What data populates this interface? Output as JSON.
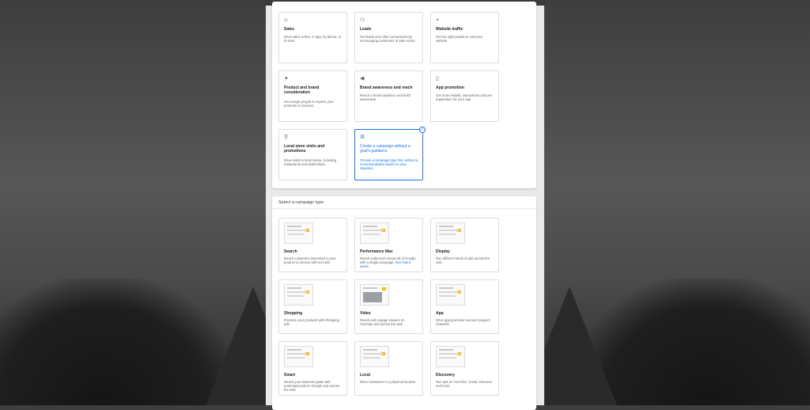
{
  "colors": {
    "accent": "#1a73e8",
    "highlight": "#fbbc04"
  },
  "goals": [
    {
      "icon": "tag-icon",
      "glyph": "⬦",
      "title": "Sales",
      "desc": "Drive sales online, in app, by phone, or in store"
    },
    {
      "icon": "people-icon",
      "glyph": "⚇",
      "title": "Leads",
      "desc": "Get leads and other conversions by encouraging customers to take action"
    },
    {
      "icon": "cursor-icon",
      "glyph": "⌖",
      "title": "Website traffic",
      "desc": "Get the right people to visit your website"
    },
    {
      "icon": "sparkle-icon",
      "glyph": "✦",
      "title": "Product and brand consideration",
      "desc": "Encourage people to explore your products or services"
    },
    {
      "icon": "megaphone-icon",
      "glyph": "◀",
      "title": "Brand awareness and reach",
      "desc": "Reach a broad audience and build awareness"
    },
    {
      "icon": "phone-icon",
      "glyph": "▯",
      "title": "App promotion",
      "desc": "Get more installs, interactions and pre-registration for your app"
    },
    {
      "icon": "location-pin-icon",
      "glyph": "⚲",
      "title": "Local store visits and promotions",
      "desc": "Drive visits to local stores, including restaurants and dealerships."
    },
    {
      "icon": "gear-icon",
      "glyph": "⚙",
      "title": "Create a campaign without a goal's guidance",
      "desc": "Choose a campaign type first, without a recommendation based on your objective",
      "selected": true
    }
  ],
  "campaign_section": {
    "title": "Select a campaign type"
  },
  "campaign_types": [
    {
      "title": "Search",
      "desc": "Reach customers interested in your product or service with text ads",
      "thumb": "lines"
    },
    {
      "title": "Performance Max",
      "desc": "Reach audiences across all of Google with a single campaign.",
      "link": "See how it works",
      "thumb": "lines"
    },
    {
      "title": "Display",
      "desc": "Run different kinds of ads across the web",
      "thumb": "lines"
    },
    {
      "title": "Shopping",
      "desc": "Promote your products with Shopping ads",
      "thumb": "lines"
    },
    {
      "title": "Video",
      "desc": "Reach and engage viewers on YouTube and across the web",
      "thumb": "video"
    },
    {
      "title": "App",
      "desc": "Drive app promotion across Google's networks",
      "thumb": "lines"
    },
    {
      "title": "Smart",
      "desc": "Reach your business goals with automated ads on Google and across the web",
      "thumb": "lines"
    },
    {
      "title": "Local",
      "desc": "Drive customers to a physical location",
      "thumb": "lines"
    },
    {
      "title": "Discovery",
      "desc": "Run ads on YouTube, Gmail, Discover, and more",
      "thumb": "lines"
    }
  ]
}
